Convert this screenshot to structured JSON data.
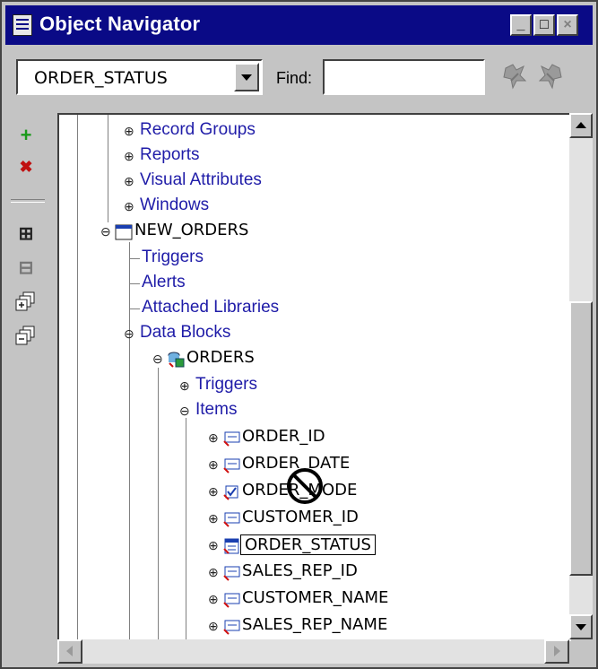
{
  "window": {
    "title": "Object Navigator",
    "buttons": {
      "minimize": "_",
      "maximize": "□",
      "close": "×"
    }
  },
  "toolbar": {
    "context_value": "ORDER_STATUS",
    "find_label": "Find:",
    "find_value": "",
    "icons": [
      "search-forward-icon",
      "search-backward-icon"
    ]
  },
  "side_toolbar": {
    "create_symbol": "+",
    "delete_symbol": "✖",
    "expand_symbol": "⊞",
    "collapse_symbol": "⊟",
    "icons": [
      "create-icon",
      "delete-icon",
      "expand-icon",
      "collapse-icon",
      "expand-all-icon",
      "collapse-all-icon"
    ]
  },
  "tree": {
    "nodes": [
      {
        "label": "Record Groups"
      },
      {
        "label": "Reports"
      },
      {
        "label": "Visual Attributes"
      },
      {
        "label": "Windows"
      },
      {
        "label": "NEW_ORDERS"
      },
      {
        "label": "Triggers"
      },
      {
        "label": "Alerts"
      },
      {
        "label": "Attached Libraries"
      },
      {
        "label": "Data Blocks"
      },
      {
        "label": "ORDERS"
      },
      {
        "label": "Triggers"
      },
      {
        "label": "Items"
      },
      {
        "label": "ORDER_ID"
      },
      {
        "label": "ORDER_DATE"
      },
      {
        "label": "ORDER_MODE"
      },
      {
        "label": "CUSTOMER_ID"
      },
      {
        "label": "ORDER_STATUS"
      },
      {
        "label": "SALES_REP_ID"
      },
      {
        "label": "CUSTOMER_NAME"
      },
      {
        "label": "SALES_REP_NAME"
      }
    ]
  }
}
